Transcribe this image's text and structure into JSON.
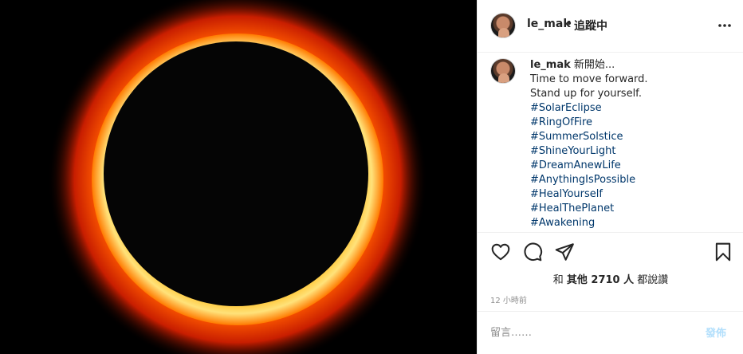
{
  "post": {
    "image_alt": "solar eclipse ring of fire",
    "author": "le_mak",
    "separator": "•",
    "follow_status": "追蹤中"
  },
  "caption": {
    "username": "le_mak",
    "first_line": " 新開始...",
    "lines": [
      "Time to move forward.",
      "Stand up for yourself."
    ],
    "hashtags": [
      "#SolarEclipse",
      "#RingOfFire",
      "#SummerSolstice",
      "#ShineYourLight",
      "#DreamAnewLife",
      "#AnythingIsPossible",
      "#HealYourself",
      "#HealThePlanet",
      "#Awakening"
    ]
  },
  "likes": {
    "prefix": "和 ",
    "others": "其他 2710 人",
    "suffix": " 都說讚"
  },
  "timestamp": "12 小時前",
  "comment": {
    "placeholder": "留言……",
    "post_label": "發佈"
  },
  "icons": {
    "more": "more-horizontal-icon",
    "like": "heart-icon",
    "comment": "comment-bubble-icon",
    "share": "paper-plane-icon",
    "save": "bookmark-icon"
  },
  "colors": {
    "hashtag": "#00376b",
    "post_button_disabled": "#b2dffc",
    "muted_text": "#8e8e8e"
  }
}
